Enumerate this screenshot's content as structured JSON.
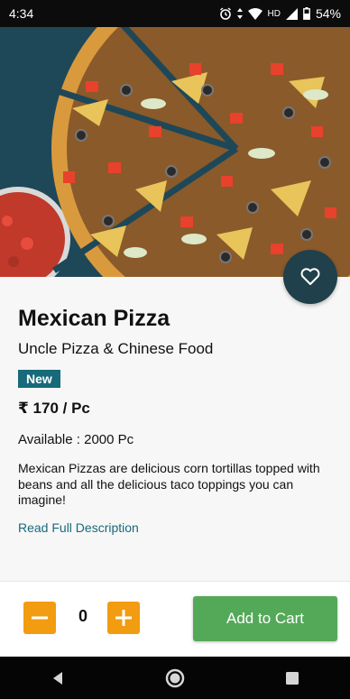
{
  "status": {
    "time": "4:34",
    "network": "HD",
    "battery": "54%"
  },
  "product": {
    "name": "Mexican Pizza",
    "vendor": "Uncle Pizza & Chinese Food",
    "badge": "New",
    "price": "₹ 170 / Pc",
    "availability": "Available : 2000 Pc",
    "description": "Mexican Pizzas are delicious corn tortillas topped with beans and all the delicious taco toppings you can imagine!",
    "read_more": "Read Full Description"
  },
  "cart": {
    "quantity": "0",
    "add_label": "Add to Cart"
  },
  "colors": {
    "accent_teal": "#176a7a",
    "fav_bg": "#20404b",
    "qty_orange": "#f29c12",
    "cart_green": "#54a958"
  },
  "icons": [
    "alarm-icon",
    "data-arrows-icon",
    "wifi-icon",
    "signal-icon",
    "battery-icon",
    "heart-icon",
    "minus-icon",
    "plus-icon",
    "back-icon",
    "home-icon",
    "recents-icon"
  ]
}
